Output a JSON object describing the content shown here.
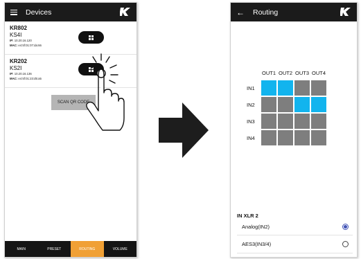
{
  "left_screen": {
    "title": "Devices",
    "logo_icon": "k-logo-icon",
    "devices": [
      {
        "name": "KR802",
        "model": "KS4I",
        "ip_label": "IP:",
        "ip": "10.20.16.120",
        "mac_label": "MAC:",
        "mac": "e4:5f:01:07:da:66"
      },
      {
        "name": "KR202",
        "model": "KS2I",
        "ip_label": "IP:",
        "ip": "10.20.16.136",
        "mac_label": "MAC:",
        "mac": "e4:5f:01:23:d5:a5"
      }
    ],
    "scan_button": "SCAN QR CODE",
    "nav": [
      "MAIN",
      "PRESET",
      "ROUTING",
      "VOLUME"
    ],
    "nav_active": "ROUTING",
    "accent_color": "#f0a035"
  },
  "right_screen": {
    "title": "Routing",
    "outputs": [
      "OUT1",
      "OUT2",
      "OUT3",
      "OUT4"
    ],
    "inputs": [
      "IN1",
      "IN2",
      "IN3",
      "IN4"
    ],
    "matrix": [
      [
        1,
        1,
        0,
        0
      ],
      [
        0,
        0,
        1,
        1
      ],
      [
        0,
        0,
        0,
        0
      ],
      [
        0,
        0,
        0,
        0
      ]
    ],
    "active_color": "#12b4ee",
    "inactive_color": "#7e7e7e",
    "section_title": "IN XLR 2",
    "options": [
      {
        "label": "Analog(IN2)",
        "selected": true
      },
      {
        "label": "AES3(IN3/4)",
        "selected": false
      }
    ]
  }
}
